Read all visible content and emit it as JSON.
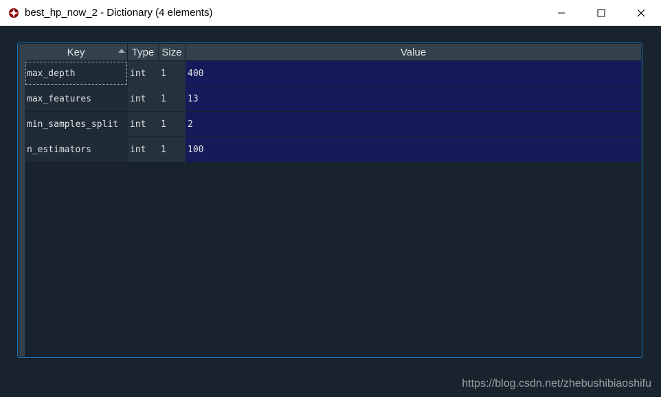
{
  "window": {
    "title": "best_hp_now_2 - Dictionary (4 elements)"
  },
  "table": {
    "headers": {
      "key": "Key",
      "type": "Type",
      "size": "Size",
      "value": "Value"
    },
    "rows": [
      {
        "key": "max_depth",
        "type": "int",
        "size": "1",
        "value": "400"
      },
      {
        "key": "max_features",
        "type": "int",
        "size": "1",
        "value": "13"
      },
      {
        "key": "min_samples_split",
        "type": "int",
        "size": "1",
        "value": "2"
      },
      {
        "key": "n_estimators",
        "type": "int",
        "size": "1",
        "value": "100"
      }
    ]
  },
  "watermark": "https://blog.csdn.net/zhebushibiaoshifu"
}
